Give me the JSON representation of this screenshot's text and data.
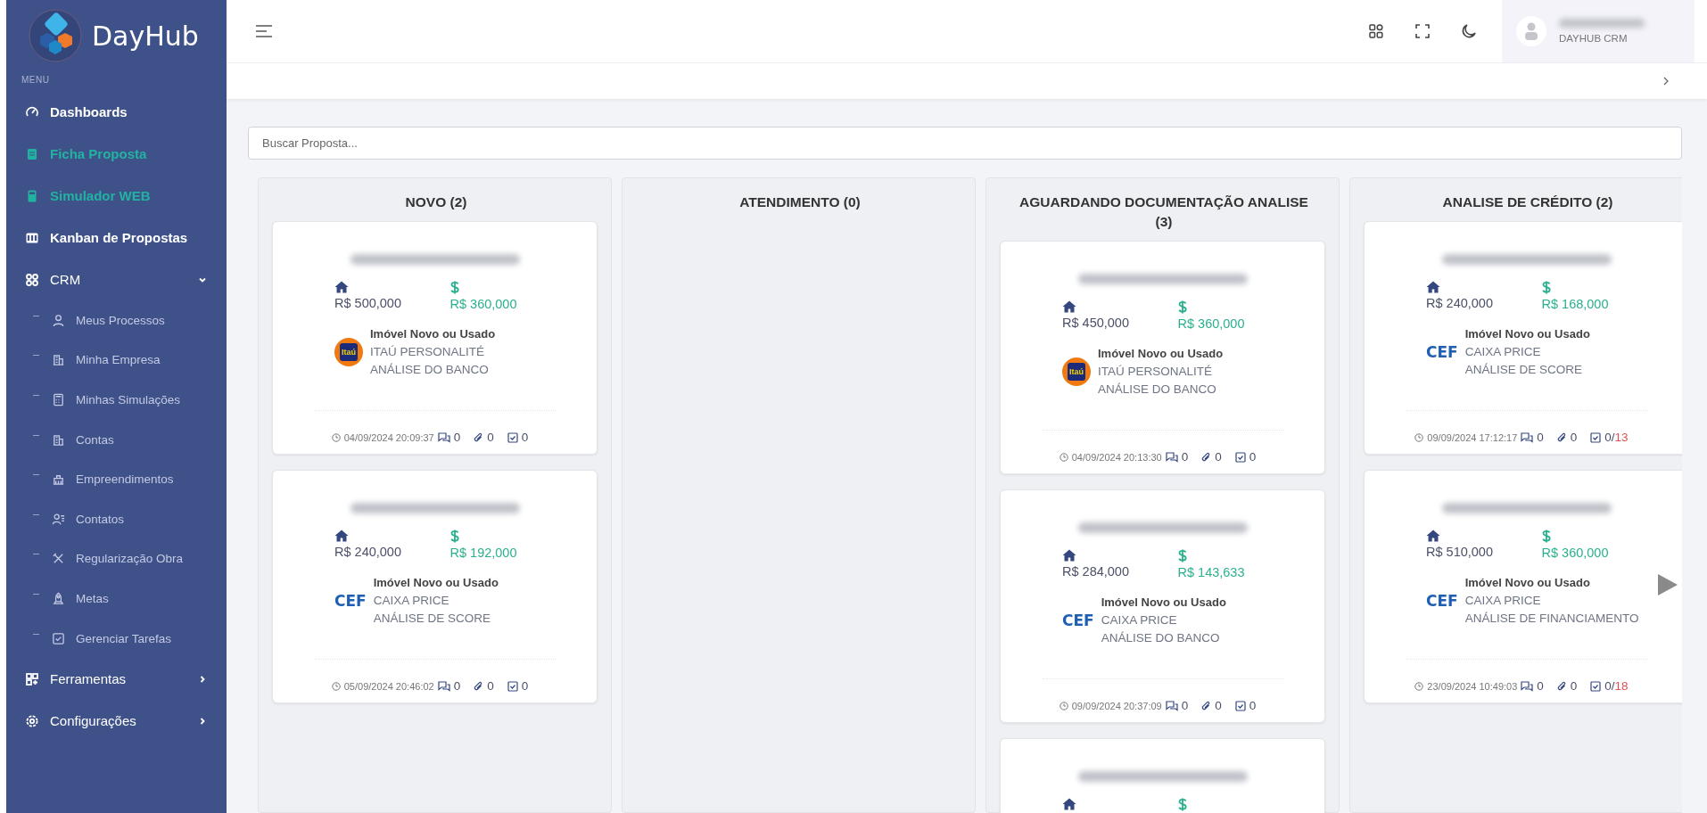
{
  "brand": {
    "name": "DayHub"
  },
  "sidebar": {
    "menu_label": "MENU",
    "items": [
      {
        "kind": "main",
        "label": "Dashboards",
        "highlighted": false
      },
      {
        "kind": "main",
        "label": "Ficha Proposta",
        "highlighted": true
      },
      {
        "kind": "main",
        "label": "Simulador WEB",
        "highlighted": true
      },
      {
        "kind": "main",
        "label": "Kanban de Propostas",
        "highlighted": false
      },
      {
        "kind": "group",
        "label": "CRM",
        "highlighted": false,
        "expanded": true,
        "children": [
          {
            "label": "Meus Processos"
          },
          {
            "label": "Minha Empresa"
          },
          {
            "label": "Minhas Simulações"
          },
          {
            "label": "Contas"
          },
          {
            "label": "Empreendimentos"
          },
          {
            "label": "Contatos"
          },
          {
            "label": "Regularização Obra"
          },
          {
            "label": "Metas"
          },
          {
            "label": "Gerenciar Tarefas"
          }
        ]
      },
      {
        "kind": "group",
        "label": "Ferramentas",
        "highlighted": false,
        "expanded": false
      },
      {
        "kind": "group",
        "label": "Configurações",
        "highlighted": false,
        "expanded": false
      }
    ]
  },
  "header": {
    "user_role": "DAYHUB CRM"
  },
  "search": {
    "placeholder": "Buscar Proposta..."
  },
  "columns": [
    {
      "title": "NOVO (2)",
      "cards": [
        {
          "kind": "full",
          "property_value": "R$ 500,000",
          "financed_value": "R$ 360,000",
          "logo": {
            "kind": "itau",
            "text": "Itaú"
          },
          "type": "Imóvel Novo ou Usado",
          "bank": "ITAÚ PERSONALITÉ",
          "stage": "ANÁLISE DO BANCO",
          "date": "04/09/2024 20:09:37",
          "comments": "0",
          "attachments": "0",
          "tasks": "0"
        },
        {
          "kind": "full",
          "property_value": "R$ 240,000",
          "financed_value": "R$ 192,000",
          "logo": {
            "kind": "cef",
            "text": "CEF"
          },
          "type": "Imóvel Novo ou Usado",
          "bank": "CAIXA PRICE",
          "stage": "ANÁLISE DE SCORE",
          "date": "05/09/2024 20:46:02",
          "comments": "0",
          "attachments": "0",
          "tasks": "0"
        }
      ]
    },
    {
      "title": "ATENDIMENTO (0)"
    },
    {
      "title": "AGUARDANDO DOCUMENTAÇÃO ANALISE (3)",
      "cards": [
        {
          "kind": "full",
          "property_value": "R$ 450,000",
          "financed_value": "R$ 360,000",
          "logo": {
            "kind": "itau",
            "text": "Itaú"
          },
          "type": "Imóvel Novo ou Usado",
          "bank": "ITAÚ PERSONALITÉ",
          "stage": "ANÁLISE DO BANCO",
          "date": "04/09/2024 20:13:30",
          "comments": "0",
          "attachments": "0",
          "tasks": "0"
        },
        {
          "kind": "full",
          "property_value": "R$ 284,000",
          "financed_value": "R$ 143,633",
          "logo": {
            "kind": "cef",
            "text": "CEF"
          },
          "type": "Imóvel Novo ou Usado",
          "bank": "CAIXA PRICE",
          "stage": "ANÁLISE DO BANCO",
          "date": "09/09/2024 20:37:09",
          "comments": "0",
          "attachments": "0",
          "tasks": "0"
        },
        {
          "kind": "cut_off"
        }
      ]
    },
    {
      "title": "ANALISE DE CRÉDITO (2)",
      "cards": [
        {
          "kind": "full",
          "property_value": "R$ 240,000",
          "financed_value": "R$ 168,000",
          "logo": {
            "kind": "cef",
            "text": "CEF"
          },
          "type": "Imóvel Novo ou Usado",
          "bank": "CAIXA PRICE",
          "stage": "ANÁLISE DE SCORE",
          "date": "09/09/2024 17:12:17",
          "comments": "0",
          "attachments": "0",
          "tasks": "0/",
          "tasks_total": "13"
        },
        {
          "kind": "full",
          "property_value": "R$ 510,000",
          "financed_value": "R$ 360,000",
          "logo": {
            "kind": "cef",
            "text": "CEF"
          },
          "type": "Imóvel Novo ou Usado",
          "bank": "CAIXA PRICE",
          "stage": "ANÁLISE DE FINANCIAMENTO",
          "date": "23/09/2024 10:49:03",
          "comments": "0",
          "attachments": "0",
          "tasks": "0/",
          "tasks_total": "18"
        }
      ]
    }
  ]
}
